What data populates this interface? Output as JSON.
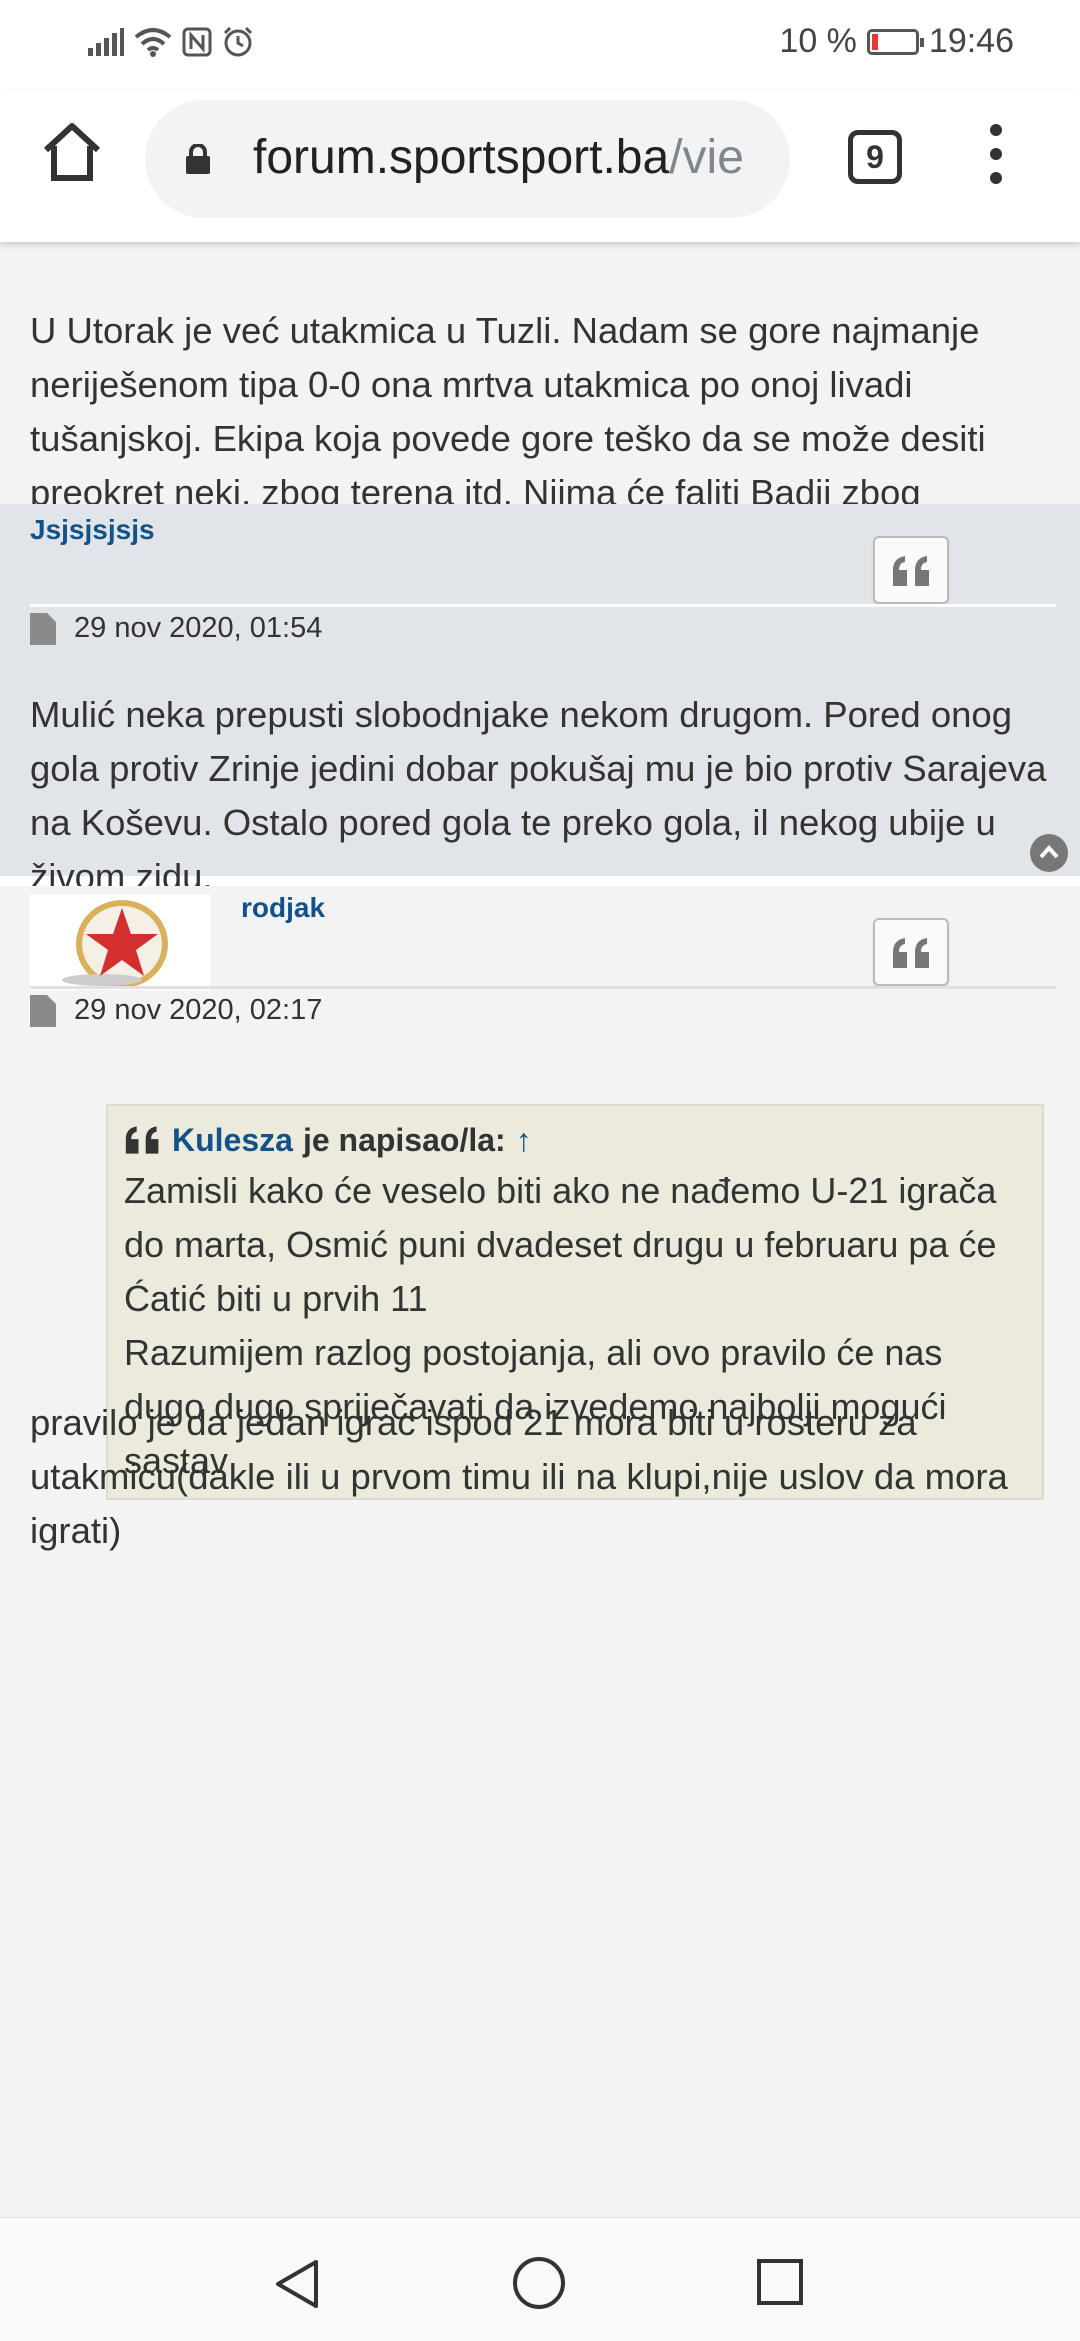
{
  "status": {
    "battery_pct": "10 %",
    "time": "19:46",
    "icons": [
      "signal-icon",
      "wifi-icon",
      "nfc-icon",
      "alarm-icon",
      "battery-icon"
    ]
  },
  "browser": {
    "url_domain": "forum.sportsport.ba",
    "url_rest": "/vie",
    "tab_count": "9"
  },
  "posts": [
    {
      "text": "U Utorak je već utakmica u Tuzli. Nadam se gore najmanje neriješenom tipa 0-0 ona mrtva utakmica po onoj livadi tušanjskoj. Ekipa koja povede gore teško da se može desiti preokret neki, zbog terena itd. Njima će faliti Badji zbog crvenog kartona i Ubiparip je povrijeđen i upitan je za utorak, a ako i nastupi pitanje je koliko je spreman. Tako da eto i to je olakšavajuća činjenica za našu lohotnu odbranu."
    },
    {
      "author": "Jsjsjsjsjs",
      "date": "29 nov 2020, 01:54",
      "text": "Mulić neka prepusti slobodnjake nekom drugom. Pored onog gola protiv Zrinje jedini dobar pokušaj mu je bio protiv Sarajeva na Koševu. Ostalo pored gola te preko gola, il nekog ubije u živom zidu."
    },
    {
      "author": "rodjak",
      "date": "29 nov 2020, 02:17",
      "quote": {
        "cite_author": "Kulesza",
        "cite_suffix": "je napisao/la:",
        "cite_arrow": "↑",
        "line1": "Zamisli kako će veselo biti ako ne nađemo U-21 igrača do marta, Osmić puni dvadeset drugu u februaru pa će Ćatić biti u prvih 11",
        "line2": "Razumijem razlog postojanja, ali ovo pravilo će nas dugo dugo spriječavati da izvedemo najbolji mogući sastav"
      },
      "text": "pravilo je da jedan igrac ispod 21 mora biti u rosteru za utakmicu(dakle ili u prvom timu ili na klupi,nije uslov da mora igrati)"
    }
  ]
}
